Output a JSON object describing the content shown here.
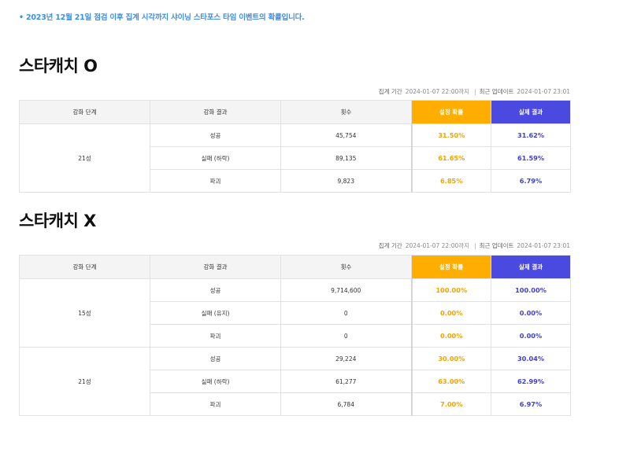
{
  "notice": "• 2023년 12월 21일 점검 이후 집계 시각까지 샤이닝 스타포스 타임 이벤트의 확률입니다.",
  "meta": {
    "period_label": "집계 기간",
    "period_value": "2024-01-07 22:00까지",
    "updated_label": "최근 업데이트",
    "updated_value": "2024-01-07 23:01"
  },
  "columns": [
    "강화 단계",
    "강화 결과",
    "횟수",
    "설정 확률",
    "실제 결과"
  ],
  "colors": {
    "setting": "#ffae00",
    "actual": "#4a4ae0",
    "notice": "#3d8fe3"
  },
  "sections": [
    {
      "title": "스타캐치 O",
      "groups": [
        {
          "stage": "21성",
          "rows": [
            {
              "result": "성공",
              "count": "45,754",
              "set": "31.50%",
              "actual": "31.62%"
            },
            {
              "result": "실패 (하락)",
              "count": "89,135",
              "set": "61.65%",
              "actual": "61.59%"
            },
            {
              "result": "파괴",
              "count": "9,823",
              "set": "6.85%",
              "actual": "6.79%"
            }
          ]
        }
      ]
    },
    {
      "title": "스타캐치 X",
      "groups": [
        {
          "stage": "15성",
          "rows": [
            {
              "result": "성공",
              "count": "9,714,600",
              "set": "100.00%",
              "actual": "100.00%"
            },
            {
              "result": "실패 (유지)",
              "count": "0",
              "set": "0.00%",
              "actual": "0.00%"
            },
            {
              "result": "파괴",
              "count": "0",
              "set": "0.00%",
              "actual": "0.00%"
            }
          ]
        },
        {
          "stage": "21성",
          "rows": [
            {
              "result": "성공",
              "count": "29,224",
              "set": "30.00%",
              "actual": "30.04%"
            },
            {
              "result": "실패 (하락)",
              "count": "61,277",
              "set": "63.00%",
              "actual": "62.99%"
            },
            {
              "result": "파괴",
              "count": "6,784",
              "set": "7.00%",
              "actual": "6.97%"
            }
          ]
        }
      ]
    }
  ]
}
